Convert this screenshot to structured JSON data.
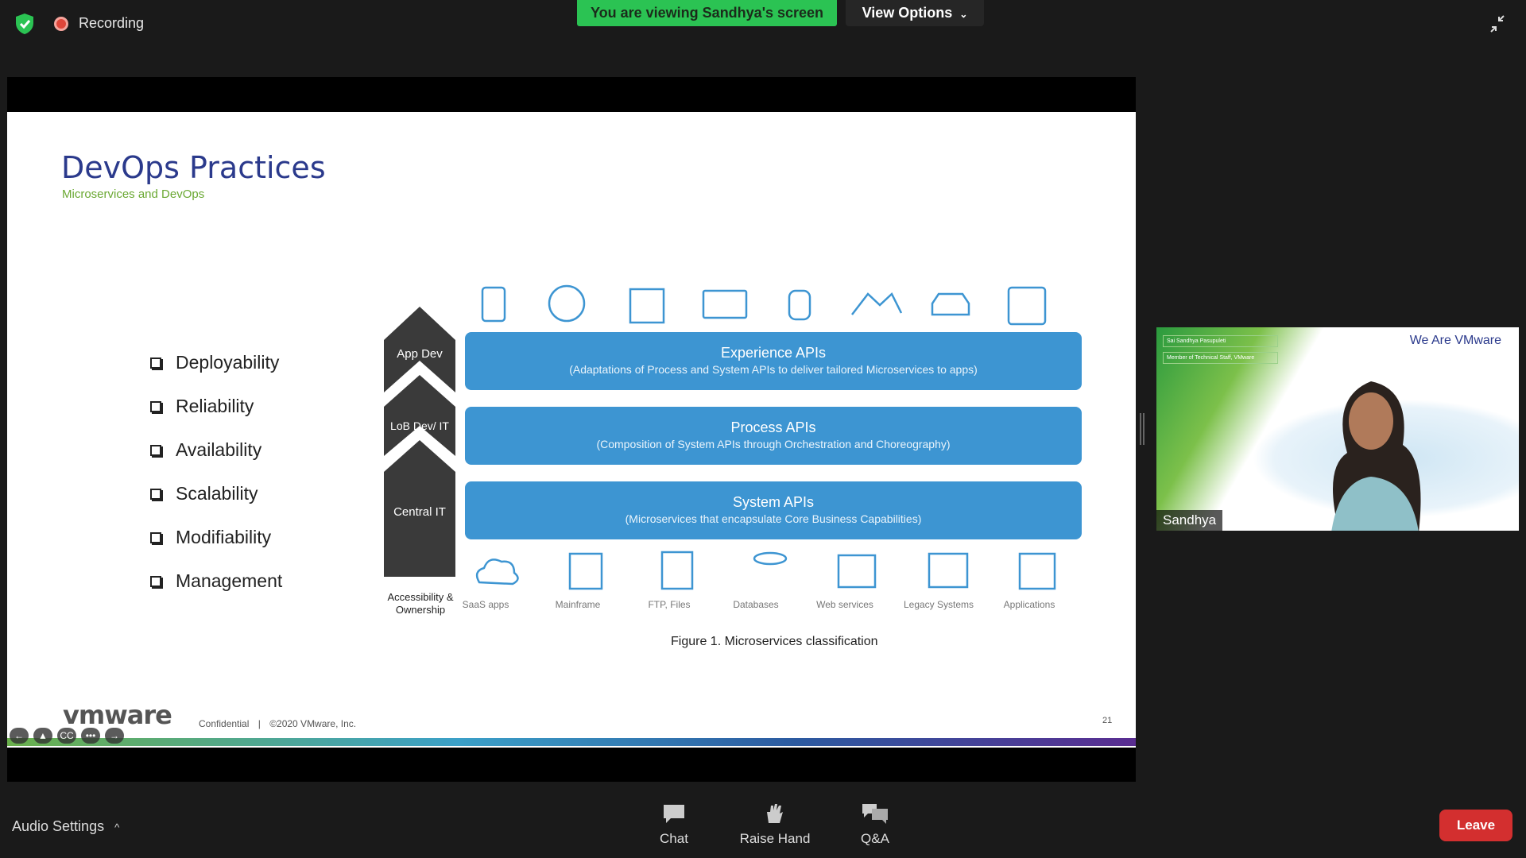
{
  "topbar": {
    "recording_label": "Recording",
    "viewing_banner": "You are viewing Sandhya's screen",
    "view_options_label": "View Options",
    "icons": [
      "shield-check-icon",
      "recording-icon",
      "exit-fullscreen-icon"
    ]
  },
  "slide": {
    "title": "DevOps Practices",
    "subtitle": "Microservices and DevOps",
    "bullets": [
      "Deployability",
      "Reliability",
      "Availability",
      "Scalability",
      "Modifiability",
      "Management"
    ],
    "arrow_labels": [
      "App Dev",
      "LoB Dev/ IT",
      "Central IT"
    ],
    "arrow_caption": "Accessibility & Ownership",
    "bands": [
      {
        "heading": "Experience APIs",
        "detail": "(Adaptations of Process and System APIs to deliver tailored Microservices to apps)"
      },
      {
        "heading": "Process APIs",
        "detail": "(Composition of System APIs through Orchestration and Choreography)"
      },
      {
        "heading": "System APIs",
        "detail": "(Microservices that encapsulate Core Business Capabilities)"
      }
    ],
    "sources": [
      "SaaS apps",
      "Mainframe",
      "FTP, Files",
      "Databases",
      "Web services",
      "Legacy Systems",
      "Applications"
    ],
    "figure_caption": "Figure 1. Microservices classification",
    "logo": "vmware",
    "footer_confidential": "Confidential",
    "footer_copyright": "©2020 VMware, Inc.",
    "page_number": "21",
    "brand_colors": {
      "title": "#2b3a8c",
      "subtitle": "#6aa832",
      "band": "#3d95d2"
    }
  },
  "participant": {
    "name": "Sandhya",
    "badge_line1": "Sai Sandhya Pasupuleti",
    "badge_line2": "Member of Technical Staff, VMware",
    "background_text": "We Are VMware"
  },
  "bottombar": {
    "audio_settings_label": "Audio Settings",
    "chat_label": "Chat",
    "raise_hand_label": "Raise Hand",
    "qa_label": "Q&A",
    "leave_label": "Leave"
  }
}
